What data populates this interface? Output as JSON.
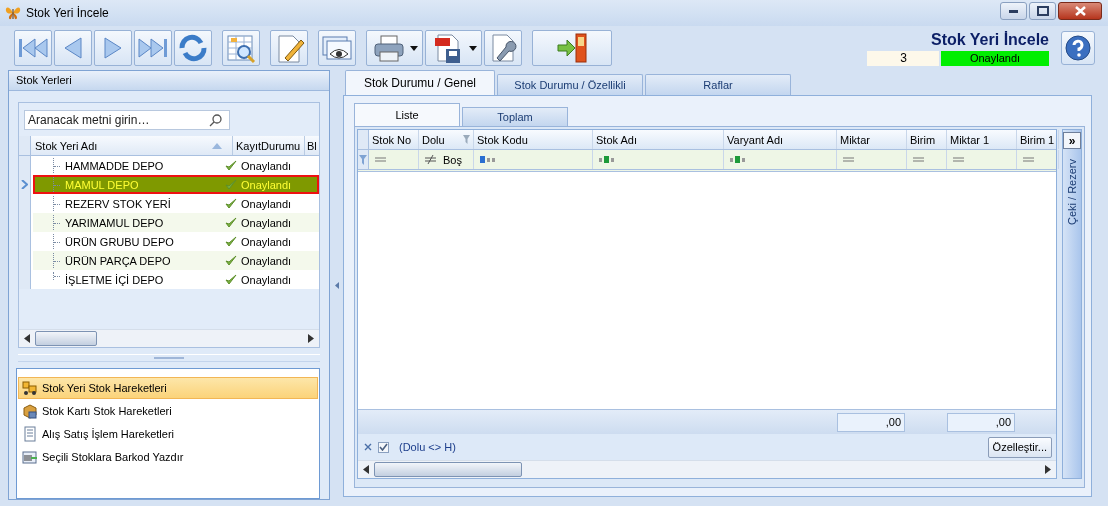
{
  "window": {
    "title": "Stok Yeri İncele"
  },
  "toolbar": [
    [
      {
        "kind": "first",
        "menu": false
      },
      {
        "kind": "prev",
        "menu": false
      },
      {
        "kind": "next",
        "menu": false
      },
      {
        "kind": "last",
        "menu": false
      },
      {
        "kind": "refresh",
        "menu": false
      }
    ],
    [
      {
        "kind": "grid_search",
        "menu": false
      }
    ],
    [
      {
        "kind": "edit",
        "menu": false
      }
    ],
    [
      {
        "kind": "preview",
        "menu": false
      }
    ],
    [
      {
        "kind": "print",
        "menu": true
      },
      {
        "kind": "pdf",
        "menu": true
      },
      {
        "kind": "tools",
        "menu": false
      }
    ],
    [
      {
        "kind": "exit",
        "menu": false
      }
    ]
  ],
  "header": {
    "title": "Stok Yeri İncele",
    "record_no": "3",
    "status": "Onaylandı",
    "approved": true
  },
  "left_panel": {
    "title": "Stok Yerleri",
    "search": {
      "placeholder": "Aranacak metni girin…"
    },
    "columns": [
      {
        "label": "Stok Yeri Adı",
        "sorted": true
      },
      {
        "label": "KayıtDurumu",
        "sorted": false
      },
      {
        "label": "Bl",
        "sorted": false
      }
    ],
    "rows": [
      {
        "name": "HAMMADDE DEPO",
        "status": "Onaylandı",
        "selected": false
      },
      {
        "name": "MAMUL DEPO",
        "status": "Onaylandı",
        "selected": true
      },
      {
        "name": "REZERV STOK YERİ",
        "status": "Onaylandı",
        "selected": false
      },
      {
        "name": "YARIMAMUL DEPO",
        "status": "Onaylandı",
        "selected": false
      },
      {
        "name": "ÜRÜN GRUBU DEPO",
        "status": "Onaylandı",
        "selected": false
      },
      {
        "name": "ÜRÜN PARÇA DEPO",
        "status": "Onaylandı",
        "selected": false
      },
      {
        "name": "İŞLETME İÇİ DEPO",
        "status": "Onaylandı",
        "selected": false
      }
    ],
    "actions": [
      {
        "kind": "forklift",
        "label": "Stok Yeri Stok Hareketleri",
        "selected": true
      },
      {
        "kind": "boxes",
        "label": "Stok Kartı Stok Hareketleri",
        "selected": false
      },
      {
        "kind": "document",
        "label": "Alış Satış İşlem Hareketleri",
        "selected": false
      },
      {
        "kind": "barcode",
        "label": "Seçili Stoklara Barkod Yazdır",
        "selected": false
      }
    ]
  },
  "tabs": [
    {
      "label": "Stok Durumu / Genel",
      "selected": true
    },
    {
      "label": "Stok Durumu / Özellikli",
      "selected": false
    },
    {
      "label": "Raflar",
      "selected": false
    }
  ],
  "subtabs": [
    {
      "label": "Liste",
      "selected": true
    },
    {
      "label": "Toplam",
      "selected": false
    }
  ],
  "grid": {
    "columns": [
      {
        "label": "Stok No",
        "filtered": false,
        "filter": {
          "kind": "equals"
        }
      },
      {
        "label": "Dolu",
        "filtered": true,
        "filter": {
          "kind": "not_equals",
          "value": "Boş"
        }
      },
      {
        "label": "Stok Kodu",
        "filtered": false,
        "filter": {
          "kind": "abc_start"
        }
      },
      {
        "label": "Stok Adı",
        "filtered": false,
        "filter": {
          "kind": "abc_mid"
        }
      },
      {
        "label": "Varyant Adı",
        "filtered": false,
        "filter": {
          "kind": "abc_mid"
        }
      },
      {
        "label": "Miktar",
        "filtered": false,
        "filter": {
          "kind": "equals"
        },
        "total": ",00"
      },
      {
        "label": "Birim",
        "filtered": false,
        "filter": {
          "kind": "equals"
        }
      },
      {
        "label": "Miktar 1",
        "filtered": false,
        "filter": {
          "kind": "equals"
        },
        "total": ",00"
      },
      {
        "label": "Birim 1",
        "filtered": false,
        "filter": {
          "kind": "equals"
        }
      }
    ],
    "filter_bar": {
      "active": true,
      "text": "(Dolu <> H)"
    },
    "customize_button": "Özelleştir..."
  },
  "side_panel": {
    "expand_button": "»",
    "title": "Çeki / Rezerv"
  }
}
